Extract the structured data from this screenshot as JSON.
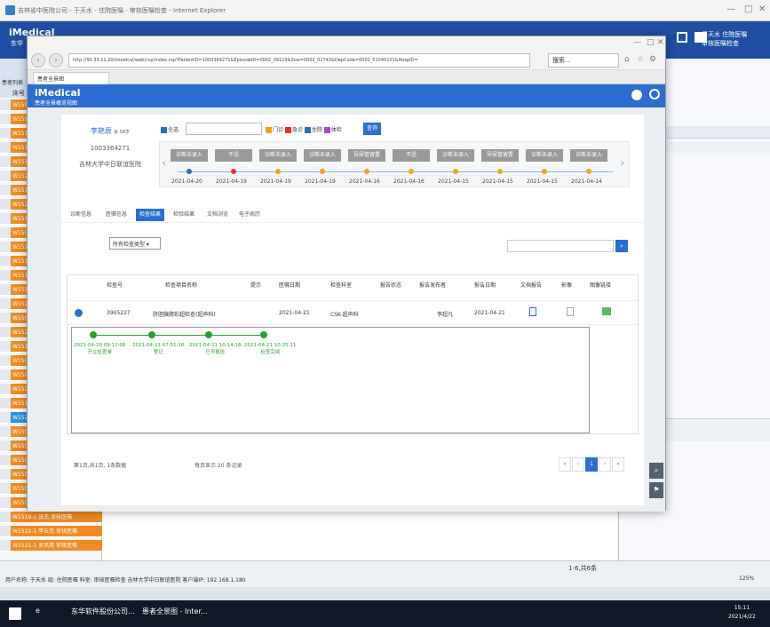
{
  "outer": {
    "title": "吉林省中医院公司 - 于天水 - 住院医嘱 - 审核医嘱检查 - Internet Explorer"
  },
  "app": {
    "logo": "iMedical",
    "logo_sub": "东华",
    "user": "于天水 住院医嘱",
    "user2": "审核医嘱检查"
  },
  "left": {
    "col1": "患者列表",
    "col2": "床号",
    "rows": [
      "W1503",
      "W1511",
      "W1515",
      "W1519",
      "W1515",
      "W1522",
      "W1515",
      "W1520",
      "W1518",
      "W1509",
      "W1510",
      "W1518",
      "W1512",
      "W1513",
      "W1522",
      "W1508",
      "W1528",
      "W1512",
      "W1503",
      "W1501",
      "W1520",
      "W1516",
      "W1527",
      "W1507",
      "W1508",
      "W1506",
      "W1506",
      "W1508",
      "W1508-2 顾淑芳 审核医嘱",
      "W1519-1 张杰 审核医嘱",
      "W1522-1 李五杰 审核医嘱",
      "W1521-1 吴凤英 审核医嘱"
    ]
  },
  "browser": {
    "url": "http://90.33.11.20/imedical/web/csp/index.csp?PatientID=1003364271&EpisodeID=0002_09119&Size=0002_02743&DepCode=0002_01040101&HospID=",
    "search": "搜索...",
    "tab": "患者全景图",
    "imed_title": "iMedical",
    "imed_sub": "患者全景概览视图"
  },
  "patient": {
    "name": "李艳辰",
    "sex_age": "女 58岁",
    "id": "1003364271",
    "hospital": "吉林大学中日联谊医院"
  },
  "filters": {
    "all": "全选",
    "outpatient": "门诊",
    "emergency": "急诊",
    "inpatient": "住院",
    "physical": "体检",
    "query": "查询"
  },
  "timeline": {
    "badges": [
      "诊断未录入",
      "不适",
      "诊断未录入",
      "诊断未录入",
      "导尿管留置",
      "不适",
      "诊断未录入",
      "导尿管留置",
      "诊断未录入",
      "诊断未录入"
    ],
    "dates": [
      "2021-04-20",
      "2021-04-19",
      "2021-04-19",
      "2021-04-19",
      "2021-04-16",
      "2021-04-16",
      "2021-04-15",
      "2021-04-15",
      "2021-04-15",
      "2021-04-14"
    ]
  },
  "subtabs": [
    "诊断信息",
    "医嘱信息",
    "检查结果",
    "检验结果",
    "文档浏览",
    "电子病历"
  ],
  "dropdown": "所有检查类型",
  "grid": {
    "headers": [
      "检查号",
      "检查项目名称",
      "提示",
      "医嘱日期",
      "检查科室",
      "报告状态",
      "报告发布者",
      "报告日期",
      "文档报告",
      "影像",
      "图像链接"
    ],
    "row": {
      "no": "3905227",
      "name": "肝胆胰脾彩超检查(超声科)",
      "date": "2021-04-21",
      "dept": "CSK-超声科",
      "reporter": "李超凡",
      "report_date": "2021-04-21"
    }
  },
  "flow": [
    {
      "time": "2021-04-20 09:12:00",
      "step": "开立检查单"
    },
    {
      "time": "2021-04-21 07:51:16",
      "step": "登记"
    },
    {
      "time": "2021-04-21 10:14:18",
      "step": "已写报告"
    },
    {
      "time": "2021-04-21 10:25:11",
      "step": "检查完成"
    }
  ],
  "pager": {
    "summary": "第1页,共1页, 1条数据",
    "per_page": "每页显示 20 条记录",
    "current": "1"
  },
  "status": {
    "line1": "用户名称: 于天水 组: 住院医嘱 科室: 审核医嘱检查 吉林大学中日联谊医院 客户端IP: 192.168.1.180",
    "line2": "1-6,共6条",
    "zoom": "125%"
  },
  "taskbar": {
    "item1": "东华软件股份公司...",
    "item2": "患者全景图 - Inter...",
    "time": "15:11",
    "date": "2021/4/22"
  }
}
